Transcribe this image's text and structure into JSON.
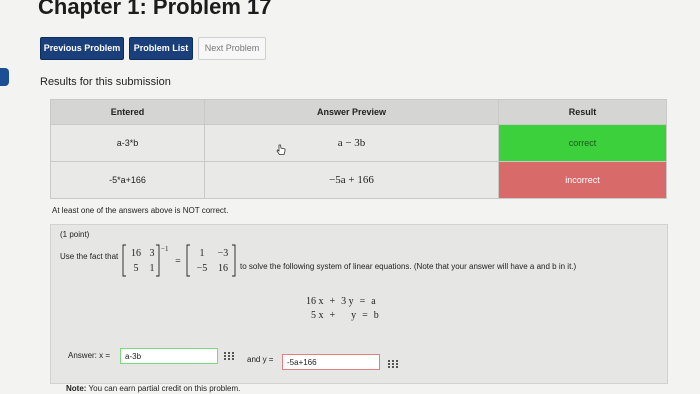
{
  "page": {
    "title": "Chapter 1: Problem 17"
  },
  "nav": {
    "previous": "Previous Problem",
    "list": "Problem List",
    "next": "Next Problem"
  },
  "results": {
    "heading": "Results for this submission",
    "headers": {
      "entered": "Entered",
      "preview": "Answer Preview",
      "result": "Result"
    },
    "rows": [
      {
        "entered": "a-3*b",
        "preview": "a − 3b",
        "result": "correct"
      },
      {
        "entered": "-5*a+166",
        "preview": "−5a + 166",
        "result": "incorrect"
      }
    ],
    "warning": "At least one of the answers above is NOT correct."
  },
  "problem": {
    "points": "(1 point)",
    "instruction_pre": "Use the fact that",
    "instruction_post": "to solve the following system of linear equations. (Note that your answer will have a and b in it.)",
    "matrix_a": [
      [
        "16",
        "3"
      ],
      [
        "5",
        "1"
      ]
    ],
    "exponent": "−1",
    "equals": "=",
    "matrix_inv": [
      [
        "1",
        "−3"
      ],
      [
        "−5",
        "16"
      ]
    ],
    "system": [
      {
        "lhs1": "16 x",
        "op": "+",
        "lhs2": "3 y",
        "eq": "=",
        "rhs": "a"
      },
      {
        "lhs1": "5 x",
        "op": "+",
        "lhs2": "y",
        "eq": "=",
        "rhs": "b"
      }
    ]
  },
  "answer": {
    "label_x": "Answer: x =",
    "value_x": "a-3b",
    "label_y": "and y =",
    "value_y": "-5a+166"
  },
  "note": {
    "bold": "Note:",
    "text": " You can earn partial credit on this problem."
  },
  "colors": {
    "correct": "#3dd03d",
    "incorrect": "#d96a6a",
    "nav": "#1a3f7a"
  }
}
